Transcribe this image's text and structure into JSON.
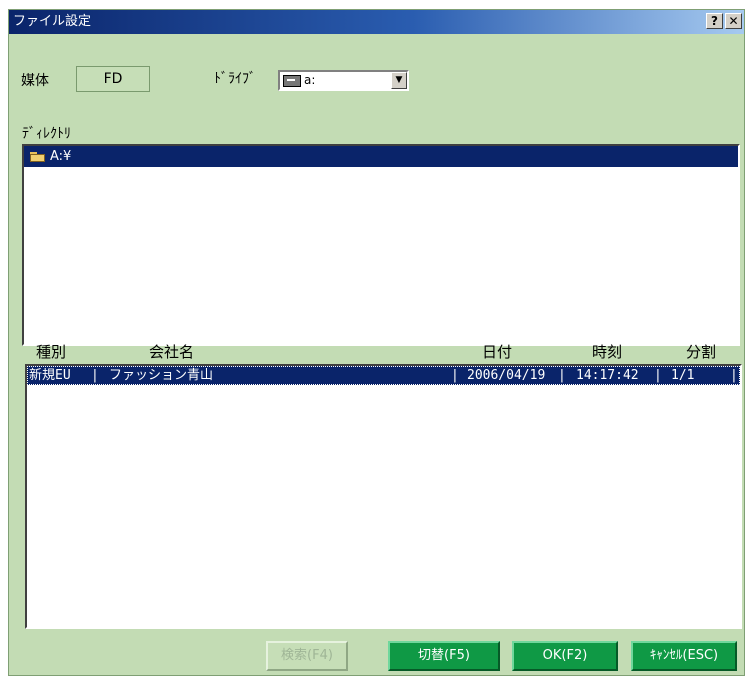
{
  "window": {
    "title": "ファイル設定",
    "help_label": "?",
    "close_label": "✕"
  },
  "media": {
    "label": "媒体",
    "value": "FD"
  },
  "drive": {
    "label": "ﾄﾞﾗｲﾌﾞ",
    "value": "a:"
  },
  "directory": {
    "label": "ﾃﾞｨﾚｸﾄﾘ",
    "selected": "A:¥"
  },
  "file_list": {
    "columns": [
      "種別",
      "会社名",
      "日付",
      "時刻",
      "分割"
    ],
    "rows": [
      {
        "type": "新規EU",
        "company": "ファッション青山",
        "date": "2006/04/19",
        "time": "14:17:42",
        "split": "1/1"
      }
    ],
    "separator": "|"
  },
  "buttons": {
    "search": "検索(F4)",
    "switch": "切替(F5)",
    "ok": "OK(F2)",
    "cancel": "ｷｬﾝｾﾙ(ESC)"
  },
  "colors": {
    "selection": "#0a246a",
    "dialog_bg": "#c3dcb4",
    "button_green": "#0f9945"
  }
}
